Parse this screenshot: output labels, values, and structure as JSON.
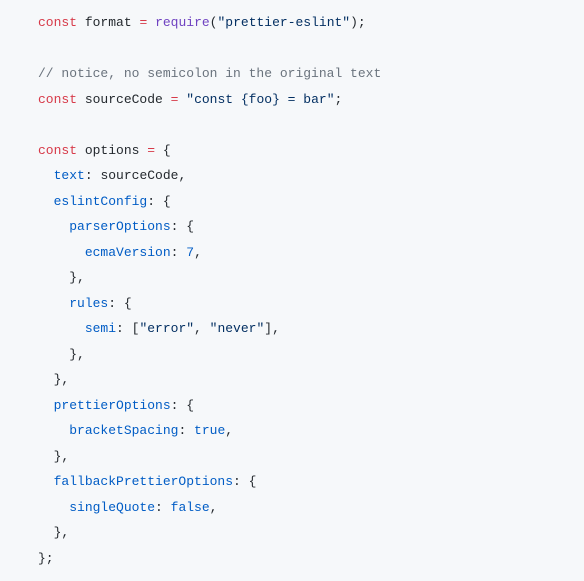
{
  "code": {
    "lines": [
      [
        {
          "cls": "tok-keyword",
          "t": "const"
        },
        {
          "cls": "tok-ident",
          "t": " format "
        },
        {
          "cls": "tok-keyword",
          "t": "="
        },
        {
          "cls": "tok-ident",
          "t": " "
        },
        {
          "cls": "tok-func",
          "t": "require"
        },
        {
          "cls": "tok-punc",
          "t": "("
        },
        {
          "cls": "tok-string",
          "t": "\"prettier-eslint\""
        },
        {
          "cls": "tok-punc",
          "t": ");"
        }
      ],
      [],
      [
        {
          "cls": "tok-comment",
          "t": "// notice, no semicolon in the original text"
        }
      ],
      [
        {
          "cls": "tok-keyword",
          "t": "const"
        },
        {
          "cls": "tok-ident",
          "t": " sourceCode "
        },
        {
          "cls": "tok-keyword",
          "t": "="
        },
        {
          "cls": "tok-ident",
          "t": " "
        },
        {
          "cls": "tok-string",
          "t": "\"const {foo} = bar\""
        },
        {
          "cls": "tok-punc",
          "t": ";"
        }
      ],
      [],
      [
        {
          "cls": "tok-keyword",
          "t": "const"
        },
        {
          "cls": "tok-ident",
          "t": " options "
        },
        {
          "cls": "tok-keyword",
          "t": "="
        },
        {
          "cls": "tok-ident",
          "t": " "
        },
        {
          "cls": "tok-punc",
          "t": "{"
        }
      ],
      [
        {
          "cls": "tok-ident",
          "t": "  "
        },
        {
          "cls": "tok-prop",
          "t": "text"
        },
        {
          "cls": "tok-punc",
          "t": ": "
        },
        {
          "cls": "tok-ident",
          "t": "sourceCode"
        },
        {
          "cls": "tok-punc",
          "t": ","
        }
      ],
      [
        {
          "cls": "tok-ident",
          "t": "  "
        },
        {
          "cls": "tok-prop",
          "t": "eslintConfig"
        },
        {
          "cls": "tok-punc",
          "t": ": {"
        }
      ],
      [
        {
          "cls": "tok-ident",
          "t": "    "
        },
        {
          "cls": "tok-prop",
          "t": "parserOptions"
        },
        {
          "cls": "tok-punc",
          "t": ": {"
        }
      ],
      [
        {
          "cls": "tok-ident",
          "t": "      "
        },
        {
          "cls": "tok-prop",
          "t": "ecmaVersion"
        },
        {
          "cls": "tok-punc",
          "t": ": "
        },
        {
          "cls": "tok-num",
          "t": "7"
        },
        {
          "cls": "tok-punc",
          "t": ","
        }
      ],
      [
        {
          "cls": "tok-ident",
          "t": "    "
        },
        {
          "cls": "tok-punc",
          "t": "},"
        }
      ],
      [
        {
          "cls": "tok-ident",
          "t": "    "
        },
        {
          "cls": "tok-prop",
          "t": "rules"
        },
        {
          "cls": "tok-punc",
          "t": ": {"
        }
      ],
      [
        {
          "cls": "tok-ident",
          "t": "      "
        },
        {
          "cls": "tok-prop",
          "t": "semi"
        },
        {
          "cls": "tok-punc",
          "t": ": ["
        },
        {
          "cls": "tok-string",
          "t": "\"error\""
        },
        {
          "cls": "tok-punc",
          "t": ", "
        },
        {
          "cls": "tok-string",
          "t": "\"never\""
        },
        {
          "cls": "tok-punc",
          "t": "],"
        }
      ],
      [
        {
          "cls": "tok-ident",
          "t": "    "
        },
        {
          "cls": "tok-punc",
          "t": "},"
        }
      ],
      [
        {
          "cls": "tok-ident",
          "t": "  "
        },
        {
          "cls": "tok-punc",
          "t": "},"
        }
      ],
      [
        {
          "cls": "tok-ident",
          "t": "  "
        },
        {
          "cls": "tok-prop",
          "t": "prettierOptions"
        },
        {
          "cls": "tok-punc",
          "t": ": {"
        }
      ],
      [
        {
          "cls": "tok-ident",
          "t": "    "
        },
        {
          "cls": "tok-prop",
          "t": "bracketSpacing"
        },
        {
          "cls": "tok-punc",
          "t": ": "
        },
        {
          "cls": "tok-bool",
          "t": "true"
        },
        {
          "cls": "tok-punc",
          "t": ","
        }
      ],
      [
        {
          "cls": "tok-ident",
          "t": "  "
        },
        {
          "cls": "tok-punc",
          "t": "},"
        }
      ],
      [
        {
          "cls": "tok-ident",
          "t": "  "
        },
        {
          "cls": "tok-prop",
          "t": "fallbackPrettierOptions"
        },
        {
          "cls": "tok-punc",
          "t": ": {"
        }
      ],
      [
        {
          "cls": "tok-ident",
          "t": "    "
        },
        {
          "cls": "tok-prop",
          "t": "singleQuote"
        },
        {
          "cls": "tok-punc",
          "t": ": "
        },
        {
          "cls": "tok-bool",
          "t": "false"
        },
        {
          "cls": "tok-punc",
          "t": ","
        }
      ],
      [
        {
          "cls": "tok-ident",
          "t": "  "
        },
        {
          "cls": "tok-punc",
          "t": "},"
        }
      ],
      [
        {
          "cls": "tok-punc",
          "t": "};"
        }
      ]
    ]
  }
}
